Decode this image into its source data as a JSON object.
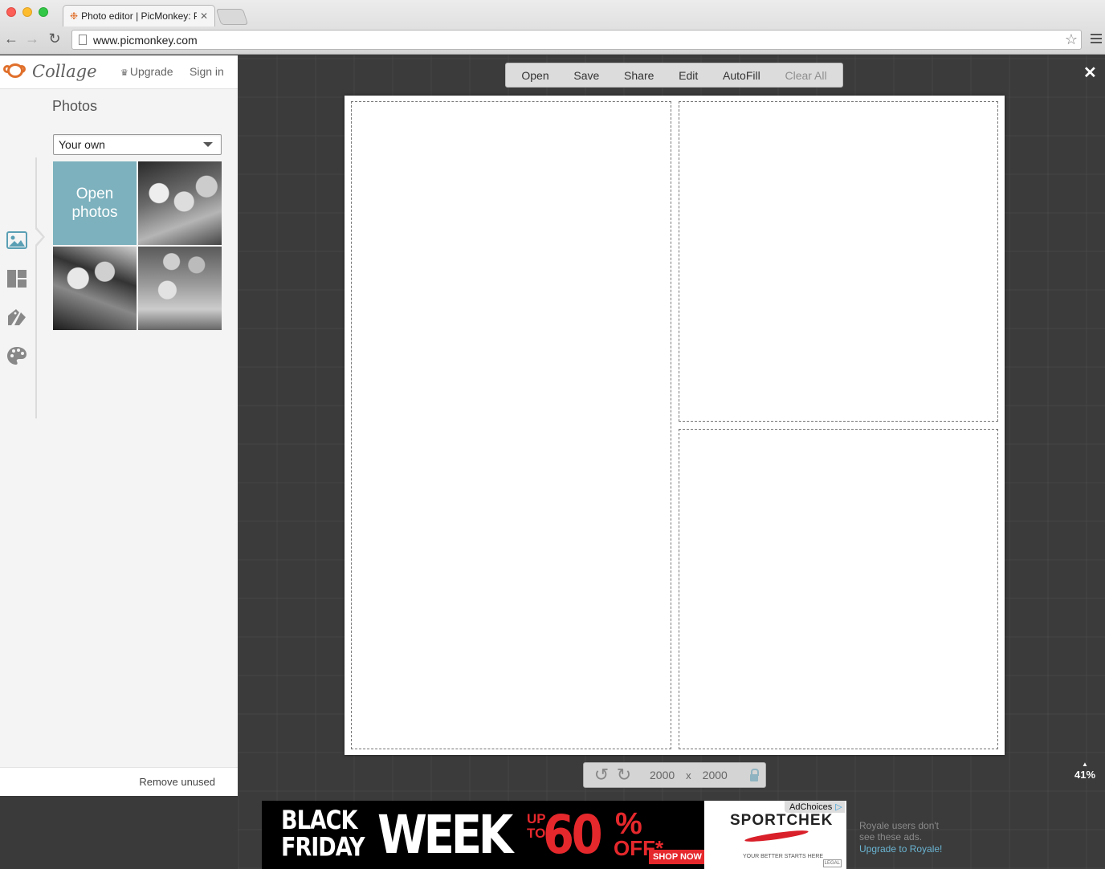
{
  "browser": {
    "tab_title": "Photo editor | PicMonkey: P",
    "url": "www.picmonkey.com"
  },
  "app": {
    "logo_text": "Collage",
    "upgrade_label": "Upgrade",
    "signin_label": "Sign in"
  },
  "sidebar": {
    "title": "Photos",
    "source_select": "Your own",
    "open_tile_line1": "Open",
    "open_tile_line2": "photos",
    "tools": [
      "photos-icon",
      "layouts-icon",
      "embellishments-icon",
      "theme-icon"
    ],
    "remove_unused_label": "Remove unused"
  },
  "toolbar": {
    "open": "Open",
    "save": "Save",
    "share": "Share",
    "edit": "Edit",
    "autofill": "AutoFill",
    "clear_all": "Clear All"
  },
  "canvas": {
    "width": "2000",
    "x": "x",
    "height": "2000",
    "zoom": "41%"
  },
  "ad": {
    "black_friday_line1": "BLACK",
    "black_friday_line2": "FRIDAY",
    "week": "WEEK",
    "upto_line1": "UP",
    "upto_line2": "TO",
    "percent": "60",
    "percent_sign": "%",
    "off": "OFF*",
    "shop_now": "SHOP NOW",
    "brand": "SPORTCHEK",
    "tagline": "YOUR BETTER STARTS HERE",
    "legal": "LEGAL",
    "adchoices": "AdChoices"
  },
  "royale": {
    "line1": "Royale users don't",
    "line2": "see these ads.",
    "link": "Upgrade to Royale!"
  },
  "colors": {
    "accent": "#7cb1bd",
    "logo_orange": "#e0702c",
    "workspace_bg": "#3b3b3b",
    "link_blue": "#6ab4d2"
  }
}
